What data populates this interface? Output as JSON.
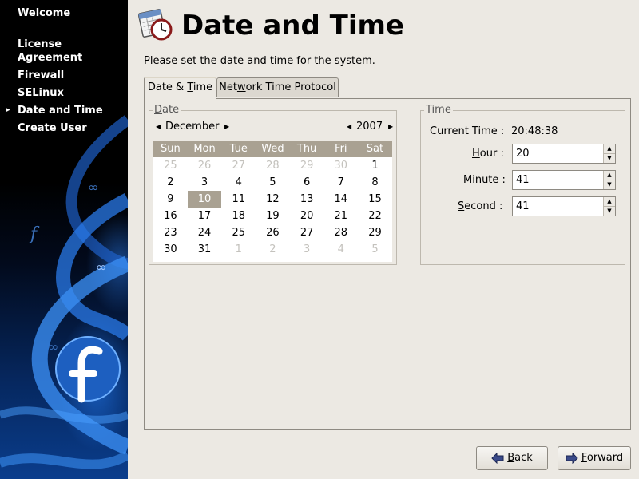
{
  "sidebar": {
    "items": [
      {
        "label": "Welcome",
        "current": false
      },
      {
        "label": "License\nAgreement",
        "current": false
      },
      {
        "label": "Firewall",
        "current": false
      },
      {
        "label": "SELinux",
        "current": false
      },
      {
        "label": "Date and Time",
        "current": true
      },
      {
        "label": "Create User",
        "current": false
      }
    ],
    "current_marker": "▸"
  },
  "header": {
    "title": "Date and Time",
    "icon": "calendar-clock-icon"
  },
  "instructions": "Please set the date and time for the system.",
  "tabs": {
    "date_time": {
      "pre": "Date & ",
      "mnemonic": "T",
      "post": "ime"
    },
    "ntp": {
      "pre": "Net",
      "mnemonic": "w",
      "post": "ork Time Protocol"
    }
  },
  "date_frame": {
    "label_mnemonic": "D",
    "label_rest": "ate",
    "month": "December",
    "year": "2007",
    "day_headers": [
      "Sun",
      "Mon",
      "Tue",
      "Wed",
      "Thu",
      "Fri",
      "Sat"
    ],
    "weeks": [
      [
        "25",
        "26",
        "27",
        "28",
        "29",
        "30",
        "1"
      ],
      [
        "2",
        "3",
        "4",
        "5",
        "6",
        "7",
        "8"
      ],
      [
        "9",
        "10",
        "11",
        "12",
        "13",
        "14",
        "15"
      ],
      [
        "16",
        "17",
        "18",
        "19",
        "20",
        "21",
        "22"
      ],
      [
        "23",
        "24",
        "25",
        "26",
        "27",
        "28",
        "29"
      ],
      [
        "30",
        "31",
        "1",
        "2",
        "3",
        "4",
        "5"
      ]
    ],
    "selected_day": "10"
  },
  "time_frame": {
    "label": "Time",
    "current_time_label": "Current Time :",
    "current_time_value": "20:48:38",
    "hour": {
      "mnemonic": "H",
      "rest": "our :",
      "value": "20"
    },
    "minute": {
      "mnemonic": "M",
      "rest": "inute :",
      "value": "41"
    },
    "second": {
      "mnemonic": "S",
      "rest": "econd :",
      "value": "41"
    }
  },
  "buttons": {
    "back": {
      "mnemonic": "B",
      "rest": "ack"
    },
    "forward": {
      "mnemonic": "F",
      "rest": "orward"
    }
  },
  "colors": {
    "calendar_header": "#a9a192",
    "selected_day": "#a9a192",
    "window_bg": "#ece9e3"
  }
}
